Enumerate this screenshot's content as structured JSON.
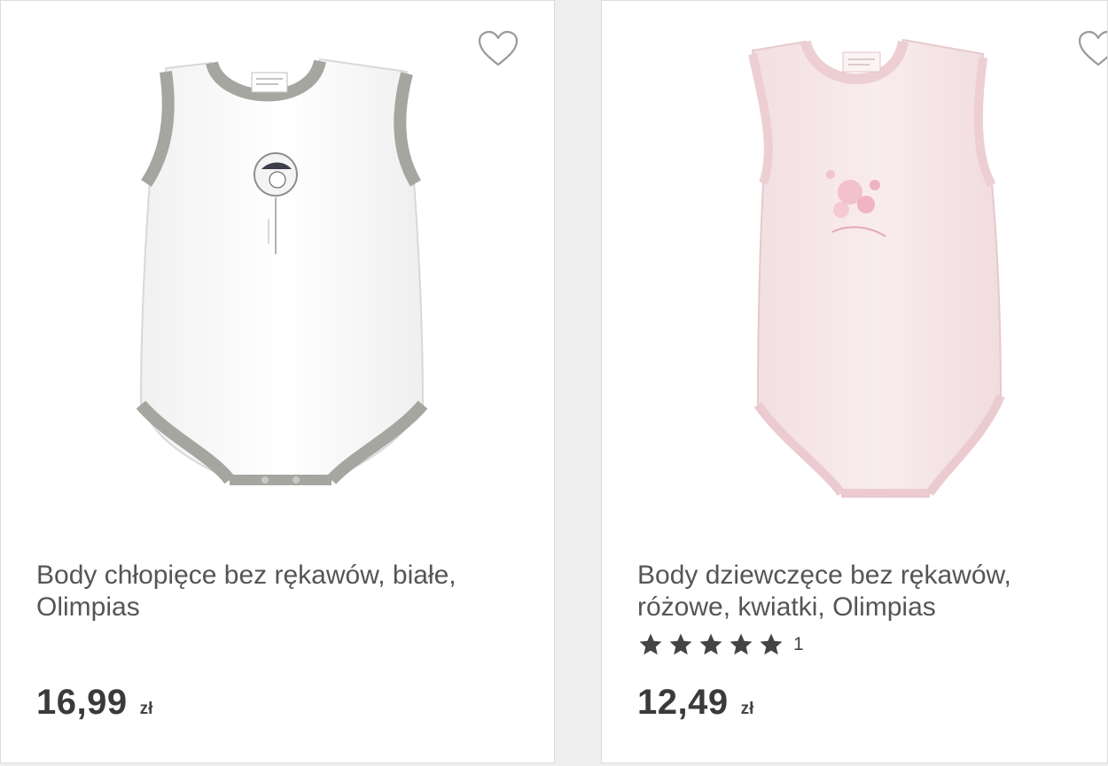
{
  "products": [
    {
      "title": "Body chłopięce bez rękawów, białe, Olimpias",
      "price": "16,99",
      "currency": "zł",
      "favorite_icon": "heart-outline-icon",
      "image": "white-sleeveless-bodysuit-grey-trim"
    },
    {
      "title": "Body dziewczęce bez rękawów, różowe, kwiatki, Olimpias",
      "rating": 5,
      "rating_count": "1",
      "price": "12,49",
      "currency": "zł",
      "favorite_icon": "heart-outline-icon",
      "image": "pink-sleeveless-bodysuit-flower-print"
    }
  ],
  "colors": {
    "text": "#555555",
    "price": "#3a3a3a",
    "star": "#444444",
    "heart": "#9a9a9a",
    "card_border": "#dcdcdc"
  }
}
